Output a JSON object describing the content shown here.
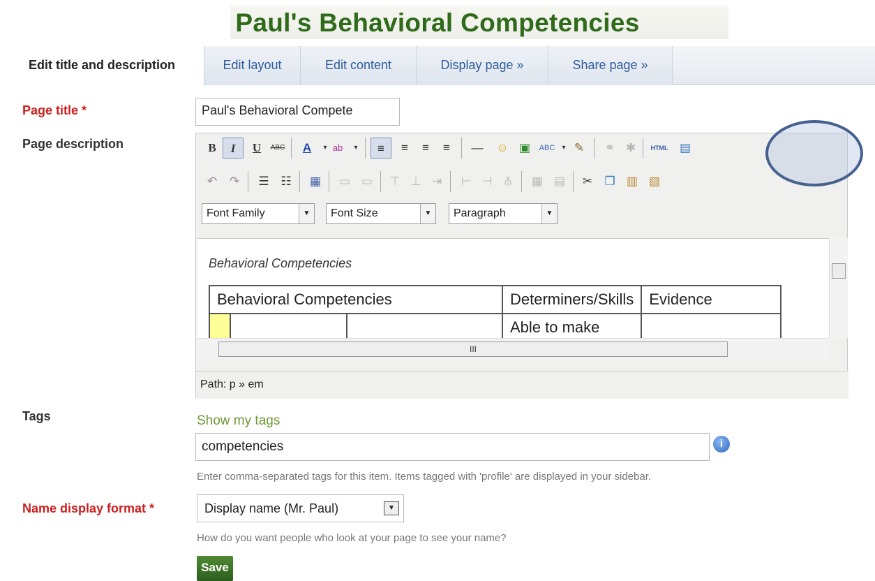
{
  "header": {
    "title": "Paul's Behavioral Competencies"
  },
  "tabs": [
    {
      "label": "Edit title and description"
    },
    {
      "label": "Edit layout"
    },
    {
      "label": "Edit content"
    },
    {
      "label": "Display page »"
    },
    {
      "label": "Share page »"
    }
  ],
  "form": {
    "page_title_label": "Page title *",
    "page_title_value": "Paul's Behavioral Compete",
    "page_description_label": "Page description",
    "tags_label": "Tags",
    "show_tags_link": "Show my tags",
    "tags_value": "competencies",
    "tags_help": "Enter comma-separated tags for this item. Items tagged with 'profile' are displayed in your sidebar.",
    "name_format_label": "Name display format *",
    "name_format_value": "Display name (Mr. Paul)",
    "name_format_help": "How do you want people who look at your page to see your name?",
    "save_label": "Save"
  },
  "editor": {
    "font_family": "Font Family",
    "font_size": "Font Size",
    "format": "Paragraph",
    "content_paragraph": "Behavioral Competencies",
    "table": {
      "headers": [
        "Behavioral Competencies",
        "Determiners/Skills",
        "Evidence"
      ],
      "row1_skill": "Able to make"
    },
    "path": "Path: p » em",
    "html_button": "HTML"
  }
}
